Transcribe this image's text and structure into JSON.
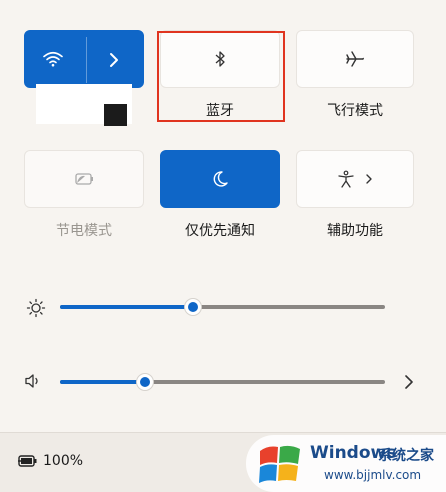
{
  "tiles": {
    "wifi": {
      "active": true
    },
    "bluetooth": {
      "label": "蓝牙"
    },
    "airplane": {
      "label": "飞行模式"
    },
    "battery_saver": {
      "label": "节电模式"
    },
    "focus": {
      "label": "仅优先通知"
    },
    "accessibility": {
      "label": "辅助功能"
    }
  },
  "sliders": {
    "brightness": {
      "level": 0.41
    },
    "volume": {
      "level": 0.26
    }
  },
  "status": {
    "battery_text": "100%"
  },
  "watermark": {
    "brand": "Windows",
    "suffix": "系统之家",
    "url": "www.bjjmlv.com"
  },
  "colors": {
    "accent": "#0f66c7",
    "highlight": "#e0341f",
    "background": "#f7f4f0"
  }
}
